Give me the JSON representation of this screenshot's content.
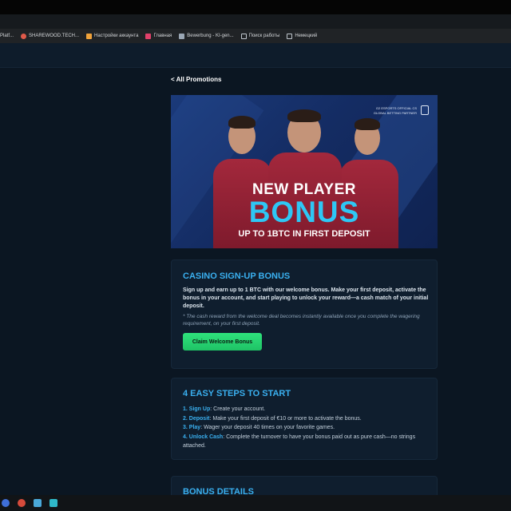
{
  "browser": {
    "bookmarks": [
      {
        "label": "Platf...",
        "color": "#3b82c4"
      },
      {
        "label": "SHAREWOOD.TECH...",
        "color": "#e05a4a"
      },
      {
        "label": "Настройки аккаунта",
        "color": "#f0a23a"
      },
      {
        "label": "Главная",
        "color": "#e0406a"
      },
      {
        "label": "Bewerbung - KI-gen...",
        "color": "#9aa7b5"
      },
      {
        "label": "Поиск работы",
        "color": "#bfc6cd"
      },
      {
        "label": "Немецкий",
        "color": "#bfc6cd"
      }
    ]
  },
  "page": {
    "back_link": "< All Promotions",
    "banner": {
      "partner_line1": "G2 ESPORTS OFFICIAL CS",
      "partner_line2": "GLOBAL BETTING PARTNER",
      "title_line1": "NEW PLAYER",
      "title_line2": "BONUS",
      "subtitle": "UP TO 1BTC IN FIRST DEPOSIT"
    },
    "signup": {
      "heading": "CASINO SIGN-UP BONUS",
      "text": "Sign up and earn up to 1 BTC with our welcome bonus. Make your first deposit, activate the bonus in your account, and start playing to unlock your reward—a cash match of your initial deposit.",
      "note": "* The cash reward from the welcome deal becomes instantly available once you complete the wagering requirement, on your first deposit.",
      "button": "Claim Welcome Bonus"
    },
    "steps_card": {
      "heading": "4 EASY STEPS TO START",
      "steps": [
        {
          "num": "1.",
          "name": "Sign Up",
          "text": ": Create your account."
        },
        {
          "num": "2.",
          "name": "Deposit",
          "text": ": Make your first deposit of €10 or more to activate the bonus."
        },
        {
          "num": "3.",
          "name": "Play",
          "text": ": Wager your deposit 40 times on your favorite games."
        },
        {
          "num": "4.",
          "name": "Unlock Cash",
          "text": ": Complete the turnover to have your bonus paid out as pure cash—no strings attached."
        }
      ]
    },
    "details_card": {
      "heading": "BONUS DETAILS"
    }
  },
  "colors": {
    "accent": "#3ab0f0",
    "button": "#22c96d",
    "background": "#0b1622"
  }
}
